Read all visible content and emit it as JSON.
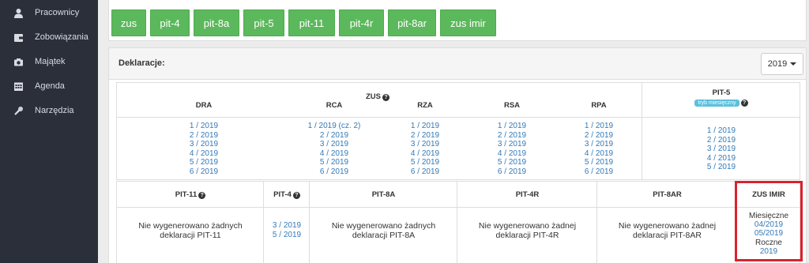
{
  "sidebar": {
    "items": [
      {
        "label": "Pracownicy",
        "icon": "user-icon"
      },
      {
        "label": "Zobowiązania",
        "icon": "wallet-icon"
      },
      {
        "label": "Majątek",
        "icon": "camera-icon"
      },
      {
        "label": "Agenda",
        "icon": "calendar-icon"
      },
      {
        "label": "Narzędzia",
        "icon": "tools-icon"
      }
    ]
  },
  "tabs": [
    "zus",
    "pit-4",
    "pit-8a",
    "pit-5",
    "pit-11",
    "pit-4r",
    "pit-8ar",
    "zus imir"
  ],
  "declarations": {
    "title": "Deklaracje:",
    "year": "2019",
    "zus": {
      "label": "ZUS",
      "columns": [
        {
          "name": "DRA",
          "items": [
            "1 / 2019",
            "2 / 2019",
            "3 / 2019",
            "4 / 2019",
            "5 / 2019",
            "6 / 2019"
          ]
        },
        {
          "name": "RCA",
          "items": [
            "1 / 2019 (cz. 2)",
            "2 / 2019",
            "3 / 2019",
            "4 / 2019",
            "5 / 2019",
            "6 / 2019"
          ]
        },
        {
          "name": "RZA",
          "items": [
            "1 / 2019",
            "2 / 2019",
            "3 / 2019",
            "4 / 2019",
            "5 / 2019",
            "6 / 2019"
          ]
        },
        {
          "name": "RSA",
          "items": [
            "1 / 2019",
            "2 / 2019",
            "3 / 2019",
            "4 / 2019",
            "5 / 2019",
            "6 / 2019"
          ]
        },
        {
          "name": "RPA",
          "items": [
            "1 / 2019",
            "2 / 2019",
            "3 / 2019",
            "4 / 2019",
            "5 / 2019",
            "6 / 2019"
          ]
        }
      ]
    },
    "pit5": {
      "label": "PIT-5",
      "badge": "tryb miesięczny",
      "items": [
        "1 / 2019",
        "2 / 2019",
        "3 / 2019",
        "4 / 2019",
        "5 / 2019"
      ]
    },
    "bottom": {
      "pit11": {
        "label": "PIT-11",
        "message_line1": "Nie wygenerowano żadnych",
        "message_line2": "deklaracji PIT-11"
      },
      "pit4": {
        "label": "PIT-4",
        "items": [
          "3 / 2019",
          "5 / 2019"
        ]
      },
      "pit8a": {
        "label": "PIT-8A",
        "message_line1": "Nie wygenerowano żadnych",
        "message_line2": "deklaracji PIT-8A"
      },
      "pit4r": {
        "label": "PIT-4R",
        "message_line1": "Nie wygenerowano żadnej",
        "message_line2": "deklaracji PIT-4R"
      },
      "pit8ar": {
        "label": "PIT-8AR",
        "message_line1": "Nie wygenerowano żadnej",
        "message_line2": "deklaracji PIT-8AR"
      },
      "zusimir": {
        "label": "ZUS IMIR",
        "monthly_label": "Miesięczne",
        "monthly_items": [
          "04/2019",
          "05/2019"
        ],
        "yearly_label": "Roczne",
        "yearly_items": [
          "2019"
        ]
      }
    }
  },
  "colors": {
    "sidebar": "#2b2f3a",
    "tab": "#5cb85c",
    "link": "#337ab7",
    "highlight": "#d9232d",
    "badge": "#5bc0de"
  }
}
